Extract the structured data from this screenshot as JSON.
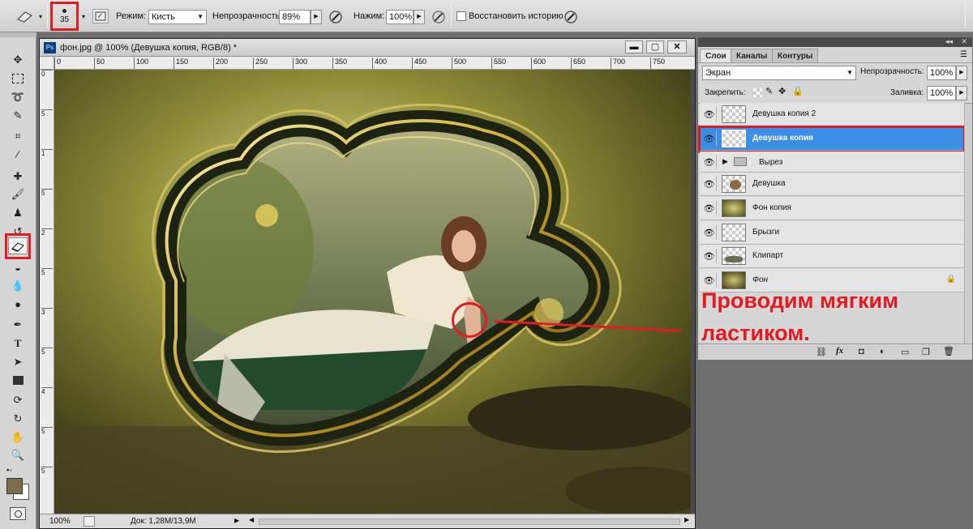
{
  "options_bar": {
    "brush_size": "35",
    "mode_label": "Режим:",
    "mode_value": "Кисть",
    "opacity_label": "Непрозрачность:",
    "opacity_value": "89%",
    "flow_label": "Нажим:",
    "flow_value": "100%",
    "history_label": "Восстановить историю"
  },
  "document": {
    "tab_title": "фон.jpg @ 100% (Девушка копия, RGB/8) *",
    "ruler_ticks": [
      "0",
      "50",
      "100",
      "150",
      "200",
      "250",
      "300",
      "350",
      "400",
      "450",
      "500",
      "550",
      "600",
      "650",
      "700",
      "750"
    ],
    "ruler_left_ticks": [
      "0",
      "5",
      "1",
      "5",
      "2",
      "5",
      "3",
      "5",
      "4",
      "5",
      "5"
    ],
    "zoom": "100%",
    "doc_info": "Док: 1,28M/13,9M"
  },
  "panel": {
    "tabs": [
      "Слои",
      "Каналы",
      "Контуры"
    ],
    "blend_mode": "Экран",
    "opacity_label": "Непрозрачность:",
    "opacity_value": "100%",
    "lock_label": "Закрепить:",
    "fill_label": "Заливка:",
    "fill_value": "100%",
    "layers": [
      {
        "name": "Девушка копия 2"
      },
      {
        "name": "Девушка копия"
      },
      {
        "name": "Вырез"
      },
      {
        "name": "Девушка"
      },
      {
        "name": "Фон копия"
      },
      {
        "name": "Брызги"
      },
      {
        "name": "Клипарт"
      },
      {
        "name": "Фон"
      }
    ]
  },
  "annotation": {
    "line1": "Проводим мягким",
    "line2": "ластиком."
  },
  "colors": {
    "highlight_red": "#e01b22",
    "selected_layer": "#3a8ee6",
    "foreground": "#7a6f49",
    "background": "#ffffff"
  }
}
